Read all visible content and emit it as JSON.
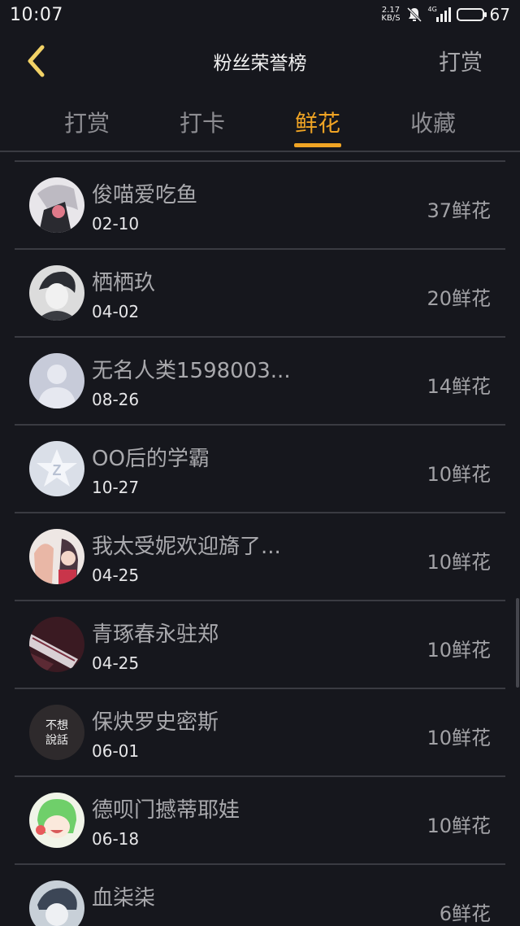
{
  "status": {
    "time": "10:07",
    "speed_value": "2.17",
    "speed_unit": "KB/S",
    "network": "4G",
    "battery": "67"
  },
  "header": {
    "title": "粉丝荣誉榜",
    "action": "打赏"
  },
  "tabs": [
    {
      "label": "打赏"
    },
    {
      "label": "打卡"
    },
    {
      "label": "鲜花",
      "active": true
    },
    {
      "label": "收藏"
    }
  ],
  "colors": {
    "accent": "#f0a424",
    "background": "#16171d",
    "divider": "#3a3b42"
  },
  "fans": [
    {
      "name": "俊喵爱吃鱼",
      "date": "02-10",
      "count": "37鲜花"
    },
    {
      "name": "栖栖玖",
      "date": "04-02",
      "count": "20鲜花"
    },
    {
      "name": "无名人类1598003...",
      "date": "08-26",
      "count": "14鲜花"
    },
    {
      "name": "OO后的学霸",
      "date": "10-27",
      "count": "10鲜花"
    },
    {
      "name": "我太受妮欢迎旖了...",
      "date": "04-25",
      "count": "10鲜花"
    },
    {
      "name": "青琢春永驻郑",
      "date": "04-25",
      "count": "10鲜花"
    },
    {
      "name": "保炔罗史密斯",
      "date": "06-01",
      "count": "10鲜花",
      "avatar_text": "不想說話"
    },
    {
      "name": "德呗门撼蒂耶娃",
      "date": "06-18",
      "count": "10鲜花"
    },
    {
      "name": "血柒柒",
      "date": "",
      "count": "6鲜花"
    }
  ]
}
